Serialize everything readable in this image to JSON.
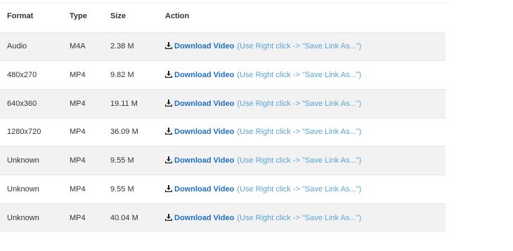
{
  "table": {
    "headers": {
      "format": "Format",
      "type": "Type",
      "size": "Size",
      "action": "Action"
    },
    "rows": [
      {
        "format": "Audio",
        "type": "M4A",
        "size": "2.38 M",
        "link_label": "Download Video",
        "hint": "(Use Right click -> \"Save Link As...\")"
      },
      {
        "format": "480x270",
        "type": "MP4",
        "size": "9.82 M",
        "link_label": "Download Video",
        "hint": "(Use Right click -> \"Save Link As...\")"
      },
      {
        "format": "640x360",
        "type": "MP4",
        "size": "19.11 M",
        "link_label": "Download Video",
        "hint": "(Use Right click -> \"Save Link As...\")"
      },
      {
        "format": "1280x720",
        "type": "MP4",
        "size": "36.09 M",
        "link_label": "Download Video",
        "hint": "(Use Right click -> \"Save Link As...\")"
      },
      {
        "format": "Unknown",
        "type": "MP4",
        "size": "9.55 M",
        "link_label": "Download Video",
        "hint": "(Use Right click -> \"Save Link As...\")"
      },
      {
        "format": "Unknown",
        "type": "MP4",
        "size": "9.55 M",
        "link_label": "Download Video",
        "hint": "(Use Right click -> \"Save Link As...\")"
      },
      {
        "format": "Unknown",
        "type": "MP4",
        "size": "40.04 M",
        "link_label": "Download Video",
        "hint": "(Use Right click -> \"Save Link As...\")"
      }
    ]
  },
  "icons": {
    "download": "download-icon"
  },
  "colors": {
    "link": "#1f6fc2",
    "hint": "#5aa3d8",
    "stripe": "#f2f2f2"
  }
}
